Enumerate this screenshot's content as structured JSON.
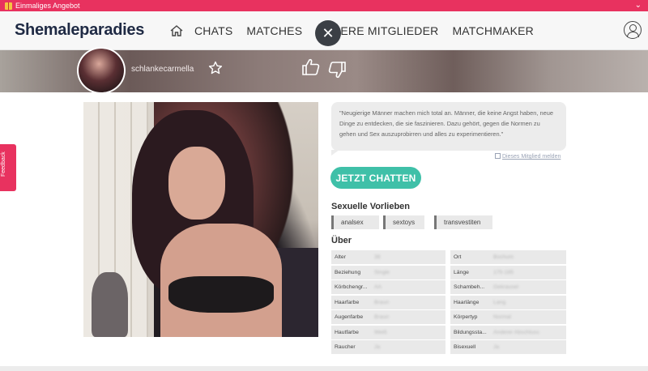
{
  "promo": {
    "label": "Einmaliges Angebot"
  },
  "header": {
    "logo_main": "Shemale",
    "logo_bold": "paradies",
    "nav": [
      "CHATS",
      "MATCHES",
      "UNSERE MITGLIEDER",
      "MATCHMAKER"
    ]
  },
  "profile": {
    "username": "schlankecarmella",
    "quote": "\"Neugierige Männer machen mich total an. Männer, die keine Angst haben, neue Dinge zu entdecken, die sie faszinieren. Dazu gehört, gegen die Normen zu gehen und Sex auszuprobirren und alles zu experimentieren.\"",
    "report_label": "Dieses Mitglied melden",
    "chat_button": "JETZT CHATTEN",
    "preferences_heading": "Sexuelle Vorlieben",
    "preferences": [
      "analsex",
      "sextoys",
      "transvestiten"
    ],
    "about_heading": "Über",
    "about": [
      [
        {
          "k": "Alter",
          "v": "38"
        },
        {
          "k": "Ort",
          "v": "Bochum"
        }
      ],
      [
        {
          "k": "Beziehung",
          "v": "Single"
        },
        {
          "k": "Länge",
          "v": "175-185"
        }
      ],
      [
        {
          "k": "Körbchengr...",
          "v": "AA"
        },
        {
          "k": "Schambeh...",
          "v": "Gekrausel"
        }
      ],
      [
        {
          "k": "Haarfarbe",
          "v": "Braun"
        },
        {
          "k": "Haarlänge",
          "v": "Lang"
        }
      ],
      [
        {
          "k": "Augenfarbe",
          "v": "Braun"
        },
        {
          "k": "Körpertyp",
          "v": "Normal"
        }
      ],
      [
        {
          "k": "Hautfarbe",
          "v": "Weiß"
        },
        {
          "k": "Bildungssta...",
          "v": "Anderer Abschluss"
        }
      ],
      [
        {
          "k": "Raucher",
          "v": "Ja"
        },
        {
          "k": "Bisexuell",
          "v": "Ja"
        }
      ]
    ]
  },
  "feedback": {
    "label": "Feedback"
  },
  "colors": {
    "brand": "#e8325f",
    "chat": "#3fc0a8"
  }
}
